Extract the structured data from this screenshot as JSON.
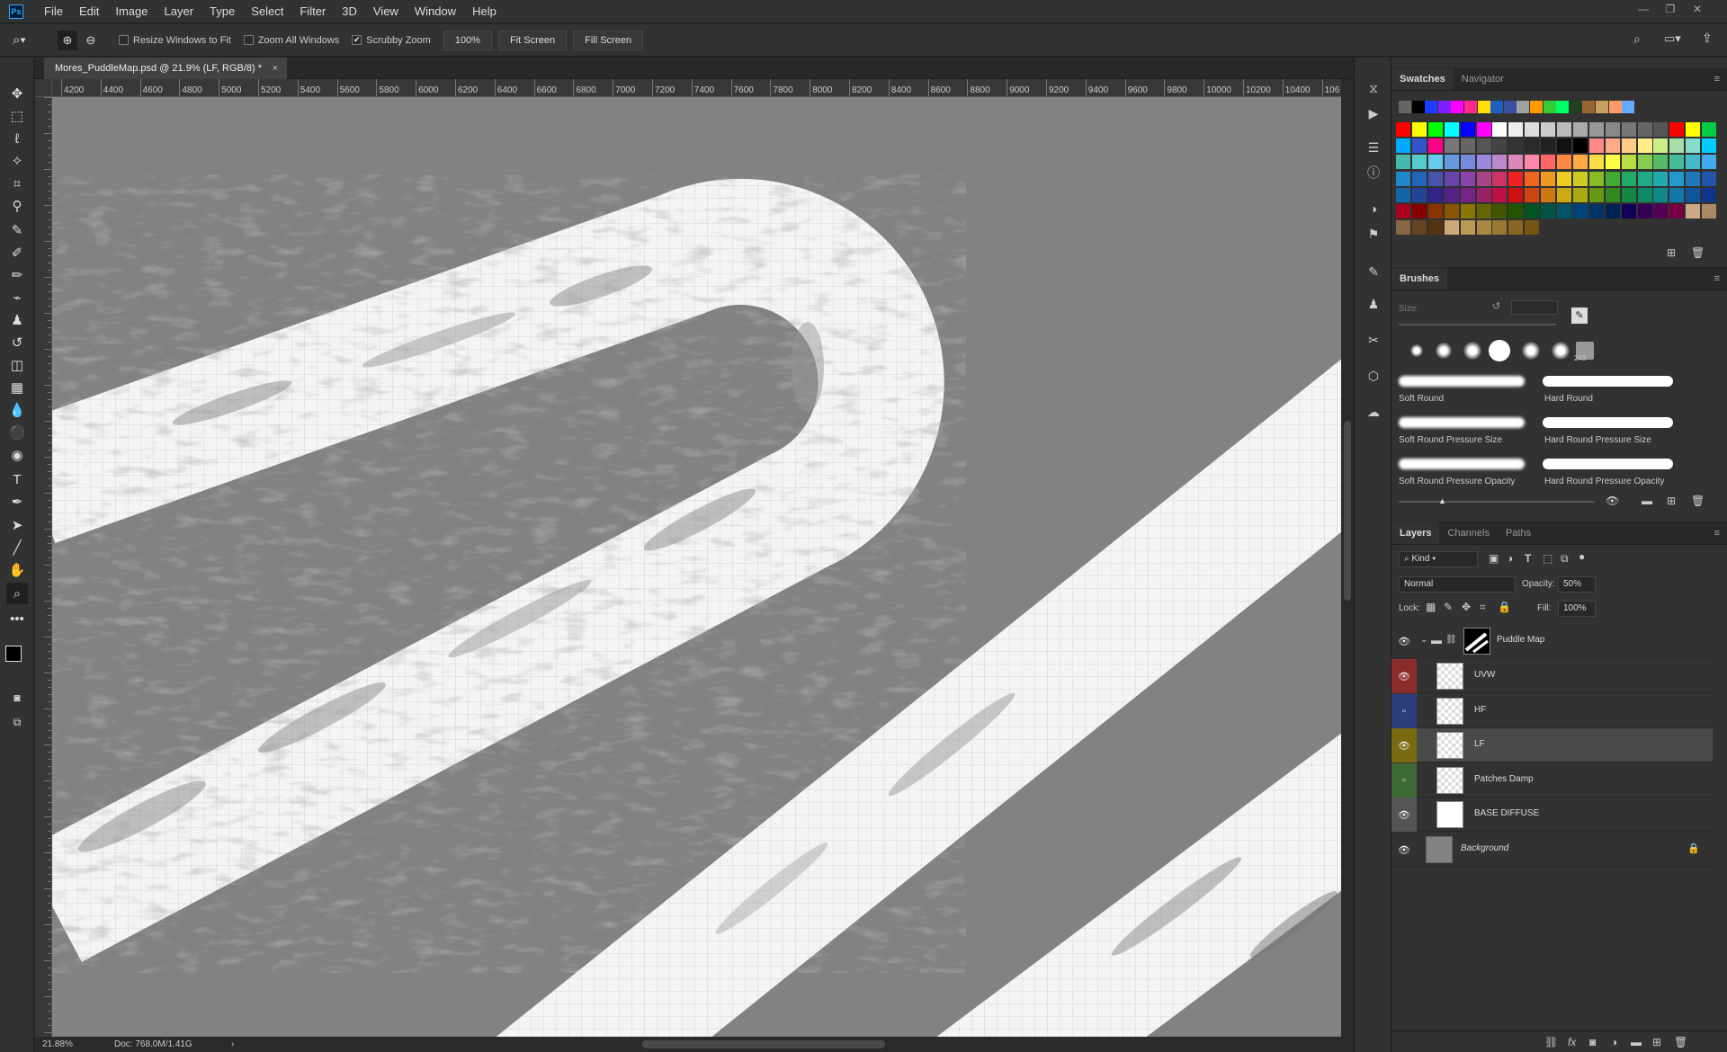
{
  "menubar": {
    "logo": "Ps",
    "items": [
      "File",
      "Edit",
      "Image",
      "Layer",
      "Type",
      "Select",
      "Filter",
      "3D",
      "View",
      "Window",
      "Help"
    ]
  },
  "options": {
    "resize_windows": "Resize Windows to Fit",
    "zoom_all": "Zoom All Windows",
    "scrubby": "Scrubby Zoom",
    "zoom_value": "100%",
    "fit_screen": "Fit Screen",
    "fill_screen": "Fill Screen"
  },
  "document": {
    "tab_title": "Mores_PuddleMap.psd @ 21.9% (LF, RGB/8) *",
    "close": "×"
  },
  "ruler": {
    "h_labels": [
      "4200",
      "4400",
      "4600",
      "4800",
      "5000",
      "5200",
      "5400",
      "5600",
      "5800",
      "6000",
      "6200",
      "6400",
      "6600",
      "6800",
      "7000",
      "7200",
      "7400",
      "7600",
      "7800",
      "8000",
      "8200",
      "8400",
      "8600",
      "8800",
      "9000",
      "9200",
      "9400",
      "9600",
      "9800",
      "10000",
      "10200",
      "10400",
      "106"
    ]
  },
  "status": {
    "zoom": "21.88%",
    "doc": "Doc: 768.0M/1.41G",
    "arrow": "›"
  },
  "swatches_panel": {
    "tabs": [
      "Swatches",
      "Navigator"
    ],
    "recent": [
      "#666666",
      "#000000",
      "#1e3cff",
      "#7f1fff",
      "#ff00ff",
      "#ff2a8a",
      "#ffe000",
      "#2060c0",
      "#3a4fa0",
      "#a0a0a0",
      "#ff9900",
      "#33cc33",
      "#00ff66",
      "#204020",
      "#996633",
      "#c8a060",
      "#ff9966",
      "#66aaff"
    ],
    "grid": [
      [
        "#ff0000",
        "#ffff00",
        "#00ff00",
        "#00ffff",
        "#0000ff",
        "#ff00ff",
        "#ffffff",
        "#eeeeee",
        "#dddddd",
        "#cccccc",
        "#bbbbbb",
        "#aaaaaa",
        "#999999",
        "#888888",
        "#777777",
        "#666666",
        "#555555",
        "#ff0000",
        "#ffff00",
        "#00cc44"
      ],
      [
        "#00aaff",
        "#3355cc",
        "#ff0088",
        "#777777",
        "#666666",
        "#555555",
        "#444444",
        "#333333",
        "#2a2a2a",
        "#222222",
        "#111111",
        "#000000",
        "#ff8888",
        "#ffaa88",
        "#ffcc88",
        "#ffee88",
        "#ccee88",
        "#aaddaa",
        "#88ddcc",
        "#00ccff"
      ],
      [
        "#44bbaa",
        "#55cccc",
        "#66ccee",
        "#6699dd",
        "#7788dd",
        "#9988dd",
        "#bb88cc",
        "#dd88bb",
        "#ff88aa",
        "#ff6666",
        "#ff8844",
        "#ffaa44",
        "#ffdd44",
        "#ffff44",
        "#bbdd44",
        "#88cc55",
        "#55bb66",
        "#44bb99",
        "#44bbcc",
        "#44aaee"
      ],
      [
        "#2288cc",
        "#2266bb",
        "#4455aa",
        "#6644aa",
        "#8844aa",
        "#aa4488",
        "#cc3366",
        "#ee2222",
        "#ee6622",
        "#ee9922",
        "#eecc22",
        "#cccc22",
        "#88bb22",
        "#44aa33",
        "#22aa66",
        "#22aa88",
        "#22aaaa",
        "#2299cc",
        "#2277bb",
        "#2255aa"
      ],
      [
        "#1166aa",
        "#224499",
        "#332288",
        "#552288",
        "#772288",
        "#992266",
        "#bb1144",
        "#cc1111",
        "#cc4411",
        "#cc7711",
        "#ccaa11",
        "#aaaa11",
        "#669911",
        "#338822",
        "#118844",
        "#118866",
        "#118888",
        "#1177aa",
        "#115599",
        "#113388"
      ],
      [
        "#aa0022",
        "#880000",
        "#883300",
        "#885500",
        "#887700",
        "#666600",
        "#445500",
        "#225500",
        "#005522",
        "#005544",
        "#005566",
        "#004477",
        "#003366",
        "#002255",
        "#110055",
        "#330055",
        "#550055",
        "#770044",
        "#ccaa88",
        "#aa8866"
      ],
      [
        "#886644",
        "#664422",
        "#553311",
        "#ccaa77",
        "#bb9955",
        "#aa8844",
        "#997733",
        "#886622",
        "#775511"
      ]
    ]
  },
  "brushes_panel": {
    "title": "Brushes",
    "size_label": "Size:",
    "preset_num": "243",
    "presets": [
      "Soft Round",
      "Hard Round",
      "Soft Round Pressure Size",
      "Hard Round Pressure Size",
      "Soft Round Pressure Opacity",
      "Hard Round Pressure Opacity"
    ]
  },
  "layers_panel": {
    "tabs": [
      "Layers",
      "Channels",
      "Paths"
    ],
    "kind": "Kind",
    "blend": "Normal",
    "opacity_label": "Opacity:",
    "opacity": "50%",
    "lock_label": "Lock:",
    "fill_label": "Fill:",
    "fill": "100%",
    "group": "Puddle Map",
    "layers": [
      {
        "name": "UVW",
        "color": "#8b2c2c",
        "visible": true,
        "selected": false
      },
      {
        "name": "HF",
        "color": "#2c3f7a",
        "visible": false,
        "selected": false
      },
      {
        "name": "LF",
        "color": "#7a6a12",
        "visible": true,
        "selected": true
      },
      {
        "name": "Patches Damp",
        "color": "#3d6a35",
        "visible": false,
        "selected": false
      },
      {
        "name": "BASE DIFFUSE",
        "color": "#555555",
        "visible": true,
        "selected": false
      }
    ],
    "background": "Background"
  }
}
